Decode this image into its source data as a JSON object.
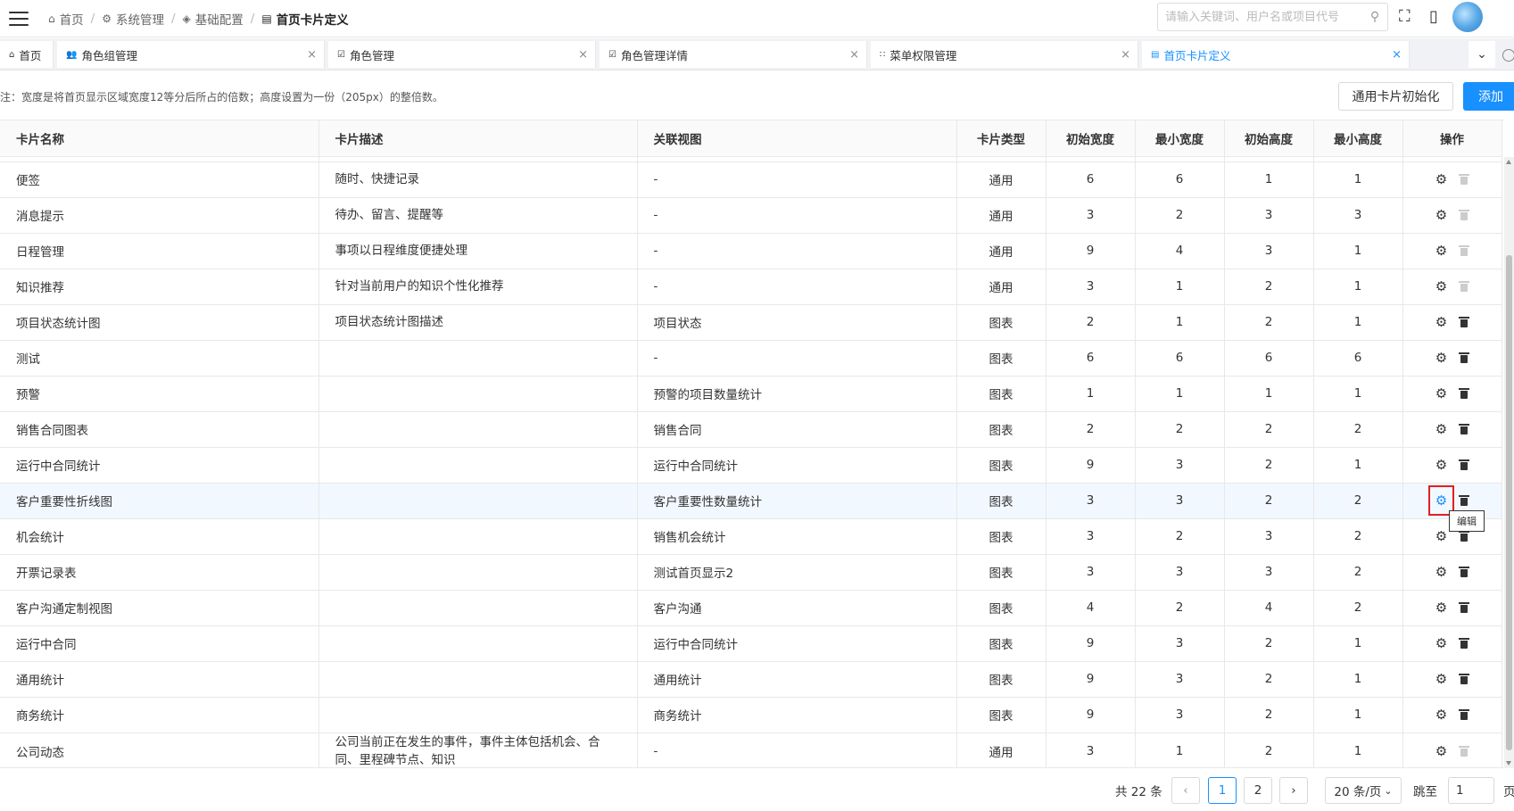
{
  "header": {
    "breadcrumb": [
      {
        "label": "首页",
        "icon": "home-icon"
      },
      {
        "label": "系统管理",
        "icon": "gear-icon"
      },
      {
        "label": "基础配置",
        "icon": "cube-icon"
      },
      {
        "label": "首页卡片定义",
        "icon": "card-icon"
      }
    ],
    "search_placeholder": "请输入关键词、用户名或项目代号"
  },
  "tabs": [
    {
      "label": "首页",
      "icon": "home-icon",
      "closable": false,
      "active": false
    },
    {
      "label": "角色组管理",
      "icon": "users-icon",
      "closable": true,
      "active": false
    },
    {
      "label": "角色管理",
      "icon": "checkbox-icon",
      "closable": true,
      "active": false
    },
    {
      "label": "角色管理详情",
      "icon": "checkbox-icon",
      "closable": true,
      "active": false
    },
    {
      "label": "菜单权限管理",
      "icon": "grid-icon",
      "closable": true,
      "active": false
    },
    {
      "label": "首页卡片定义",
      "icon": "card-icon",
      "closable": true,
      "active": true
    }
  ],
  "note": "注：宽度是将首页显示区域宽度12等分后所占的倍数；高度设置为一份（205px）的整倍数。",
  "buttons": {
    "init": "通用卡片初始化",
    "add": "添加"
  },
  "table": {
    "columns": [
      "卡片名称",
      "卡片描述",
      "关联视图",
      "卡片类型",
      "初始宽度",
      "最小宽度",
      "初始高度",
      "最小高度",
      "操作"
    ],
    "rows": [
      {
        "name": "便签",
        "desc": "随时、快捷记录",
        "view": "-",
        "type": "通用",
        "iw": "6",
        "mw": "6",
        "ih": "1",
        "mh": "1",
        "delete_enabled": false
      },
      {
        "name": "消息提示",
        "desc": "待办、留言、提醒等",
        "view": "-",
        "type": "通用",
        "iw": "3",
        "mw": "2",
        "ih": "3",
        "mh": "3",
        "delete_enabled": false
      },
      {
        "name": "日程管理",
        "desc": "事项以日程维度便捷处理",
        "view": "-",
        "type": "通用",
        "iw": "9",
        "mw": "4",
        "ih": "3",
        "mh": "1",
        "delete_enabled": false
      },
      {
        "name": "知识推荐",
        "desc": "针对当前用户的知识个性化推荐",
        "view": "-",
        "type": "通用",
        "iw": "3",
        "mw": "1",
        "ih": "2",
        "mh": "1",
        "delete_enabled": false
      },
      {
        "name": "项目状态统计图",
        "desc": "项目状态统计图描述",
        "view": "项目状态",
        "type": "图表",
        "iw": "2",
        "mw": "1",
        "ih": "2",
        "mh": "1",
        "delete_enabled": true
      },
      {
        "name": "测试",
        "desc": "",
        "view": "-",
        "type": "图表",
        "iw": "6",
        "mw": "6",
        "ih": "6",
        "mh": "6",
        "delete_enabled": true
      },
      {
        "name": "预警",
        "desc": "",
        "view": "预警的项目数量统计",
        "type": "图表",
        "iw": "1",
        "mw": "1",
        "ih": "1",
        "mh": "1",
        "delete_enabled": true
      },
      {
        "name": "销售合同图表",
        "desc": "",
        "view": "销售合同",
        "type": "图表",
        "iw": "2",
        "mw": "2",
        "ih": "2",
        "mh": "2",
        "delete_enabled": true
      },
      {
        "name": "运行中合同统计",
        "desc": "",
        "view": "运行中合同统计",
        "type": "图表",
        "iw": "9",
        "mw": "3",
        "ih": "2",
        "mh": "1",
        "delete_enabled": true
      },
      {
        "name": "客户重要性折线图",
        "desc": "",
        "view": "客户重要性数量统计",
        "type": "图表",
        "iw": "3",
        "mw": "3",
        "ih": "2",
        "mh": "2",
        "delete_enabled": true,
        "highlighted": true
      },
      {
        "name": "机会统计",
        "desc": "",
        "view": "销售机会统计",
        "type": "图表",
        "iw": "3",
        "mw": "2",
        "ih": "3",
        "mh": "2",
        "delete_enabled": true
      },
      {
        "name": "开票记录表",
        "desc": "",
        "view": "测试首页显示2",
        "type": "图表",
        "iw": "3",
        "mw": "3",
        "ih": "3",
        "mh": "2",
        "delete_enabled": true
      },
      {
        "name": "客户沟通定制视图",
        "desc": "",
        "view": "客户沟通",
        "type": "图表",
        "iw": "4",
        "mw": "2",
        "ih": "4",
        "mh": "2",
        "delete_enabled": true
      },
      {
        "name": "运行中合同",
        "desc": "",
        "view": "运行中合同统计",
        "type": "图表",
        "iw": "9",
        "mw": "3",
        "ih": "2",
        "mh": "1",
        "delete_enabled": true
      },
      {
        "name": "通用统计",
        "desc": "",
        "view": "通用统计",
        "type": "图表",
        "iw": "9",
        "mw": "3",
        "ih": "2",
        "mh": "1",
        "delete_enabled": true
      },
      {
        "name": "商务统计",
        "desc": "",
        "view": "商务统计",
        "type": "图表",
        "iw": "9",
        "mw": "3",
        "ih": "2",
        "mh": "1",
        "delete_enabled": true
      },
      {
        "name": "公司动态",
        "desc": "公司当前正在发生的事件，事件主体包括机会、合同、里程碑节点、知识",
        "view": "-",
        "type": "通用",
        "iw": "3",
        "mw": "1",
        "ih": "2",
        "mh": "1",
        "delete_enabled": false
      }
    ]
  },
  "tooltip": "编辑",
  "pagination": {
    "total": "共 22 条",
    "pages": [
      "1",
      "2"
    ],
    "current": "1",
    "page_size": "20 条/页",
    "jump_label": "跳至",
    "jump_value": "1",
    "page_suffix": "页"
  },
  "colors": {
    "accent": "#1890ff",
    "highlight_row": "#f2f8ff",
    "focus_outline": "#e02020"
  }
}
